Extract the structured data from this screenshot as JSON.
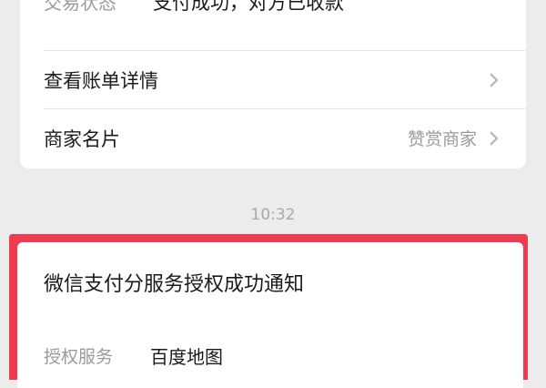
{
  "transaction": {
    "status_label": "交易状态",
    "status_value": "支付成功，对方已收款"
  },
  "rows": [
    {
      "label": "查看账单详情",
      "value": "",
      "icon": "chevron-right-icon"
    },
    {
      "label": "商家名片",
      "value": "赞赏商家",
      "icon": "chevron-right-icon"
    }
  ],
  "timestamp": "10:32",
  "notification": {
    "title": "微信支付分服务授权成功通知",
    "service_label": "授权服务",
    "service_value": "百度地图"
  },
  "colors": {
    "background": "#ececec",
    "card": "#ffffff",
    "highlight_border": "#f03a4f",
    "muted_text": "#9b9b9b"
  }
}
